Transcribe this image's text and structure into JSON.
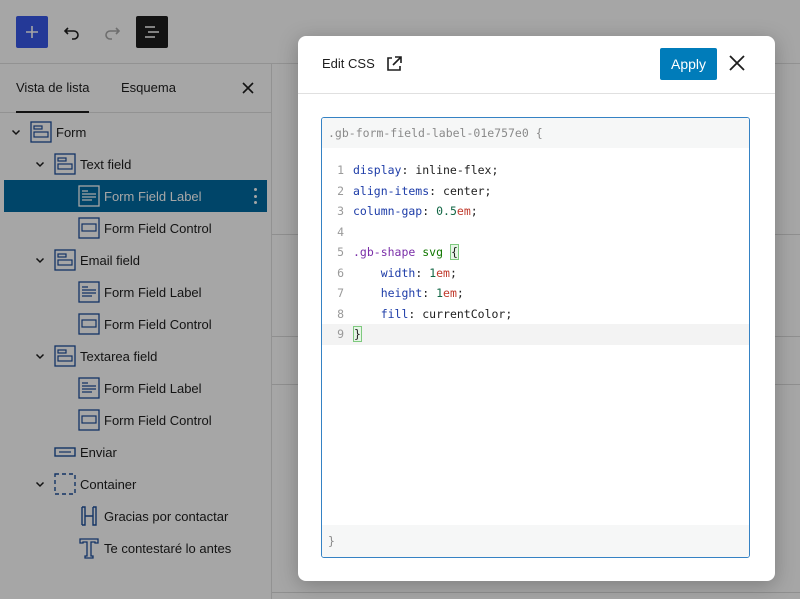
{
  "toolbar": {
    "add": "add",
    "undo": "undo",
    "redo": "redo",
    "list_view": "list-view"
  },
  "panel": {
    "tabs": [
      "Vista de lista",
      "Esquema"
    ],
    "tree": [
      {
        "label": "Form",
        "level": 0,
        "icon": "form-icon",
        "chevron": true
      },
      {
        "label": "Text field",
        "level": 1,
        "icon": "field-icon",
        "chevron": true
      },
      {
        "label": "Form Field Label",
        "level": 2,
        "icon": "label-icon",
        "chevron": false,
        "selected": true
      },
      {
        "label": "Form Field Control",
        "level": 2,
        "icon": "control-icon",
        "chevron": false
      },
      {
        "label": "Email field",
        "level": 1,
        "icon": "field-icon",
        "chevron": true
      },
      {
        "label": "Form Field Label",
        "level": 2,
        "icon": "label-icon",
        "chevron": false
      },
      {
        "label": "Form Field Control",
        "level": 2,
        "icon": "control-icon",
        "chevron": false
      },
      {
        "label": "Textarea field",
        "level": 1,
        "icon": "field-icon",
        "chevron": true
      },
      {
        "label": "Form Field Label",
        "level": 2,
        "icon": "label-icon",
        "chevron": false
      },
      {
        "label": "Form Field Control",
        "level": 2,
        "icon": "control-icon",
        "chevron": false
      },
      {
        "label": "Enviar",
        "level": 1,
        "icon": "button-icon",
        "chevron": false
      },
      {
        "label": "Container",
        "level": 1,
        "icon": "container-icon",
        "chevron": true
      },
      {
        "label": "Gracias por contactar",
        "level": 2,
        "icon": "heading-icon",
        "chevron": false
      },
      {
        "label": "Te contestaré lo antes",
        "level": 2,
        "icon": "text-icon",
        "chevron": false
      }
    ]
  },
  "modal": {
    "title": "Edit CSS",
    "apply_label": "Apply",
    "selector": ".gb-form-field-label-01e757e0 {",
    "closing": "}",
    "lines": [
      {
        "n": "1",
        "parts": [
          [
            "prop",
            "display"
          ],
          [
            "plain",
            ": inline-flex;"
          ]
        ]
      },
      {
        "n": "2",
        "parts": [
          [
            "prop",
            "align-items"
          ],
          [
            "plain",
            ": center;"
          ]
        ]
      },
      {
        "n": "3",
        "parts": [
          [
            "prop",
            "column-gap"
          ],
          [
            "plain",
            ": "
          ],
          [
            "num",
            "0.5"
          ],
          [
            "unit",
            "em"
          ],
          [
            "plain",
            ";"
          ]
        ]
      },
      {
        "n": "4",
        "parts": []
      },
      {
        "n": "5",
        "parts": [
          [
            "sel",
            ".gb-shape"
          ],
          [
            "plain",
            " "
          ],
          [
            "tag",
            "svg"
          ],
          [
            "plain",
            " "
          ],
          [
            "brace",
            "{"
          ]
        ]
      },
      {
        "n": "6",
        "parts": [
          [
            "plain",
            "    "
          ],
          [
            "prop",
            "width"
          ],
          [
            "plain",
            ": "
          ],
          [
            "num",
            "1"
          ],
          [
            "unit",
            "em"
          ],
          [
            "plain",
            ";"
          ]
        ]
      },
      {
        "n": "7",
        "parts": [
          [
            "plain",
            "    "
          ],
          [
            "prop",
            "height"
          ],
          [
            "plain",
            ": "
          ],
          [
            "num",
            "1"
          ],
          [
            "unit",
            "em"
          ],
          [
            "plain",
            ";"
          ]
        ]
      },
      {
        "n": "8",
        "parts": [
          [
            "plain",
            "    "
          ],
          [
            "prop",
            "fill"
          ],
          [
            "plain",
            ": currentColor;"
          ]
        ]
      },
      {
        "n": "9",
        "parts": [
          [
            "brace",
            "}"
          ]
        ],
        "active": true
      }
    ]
  }
}
